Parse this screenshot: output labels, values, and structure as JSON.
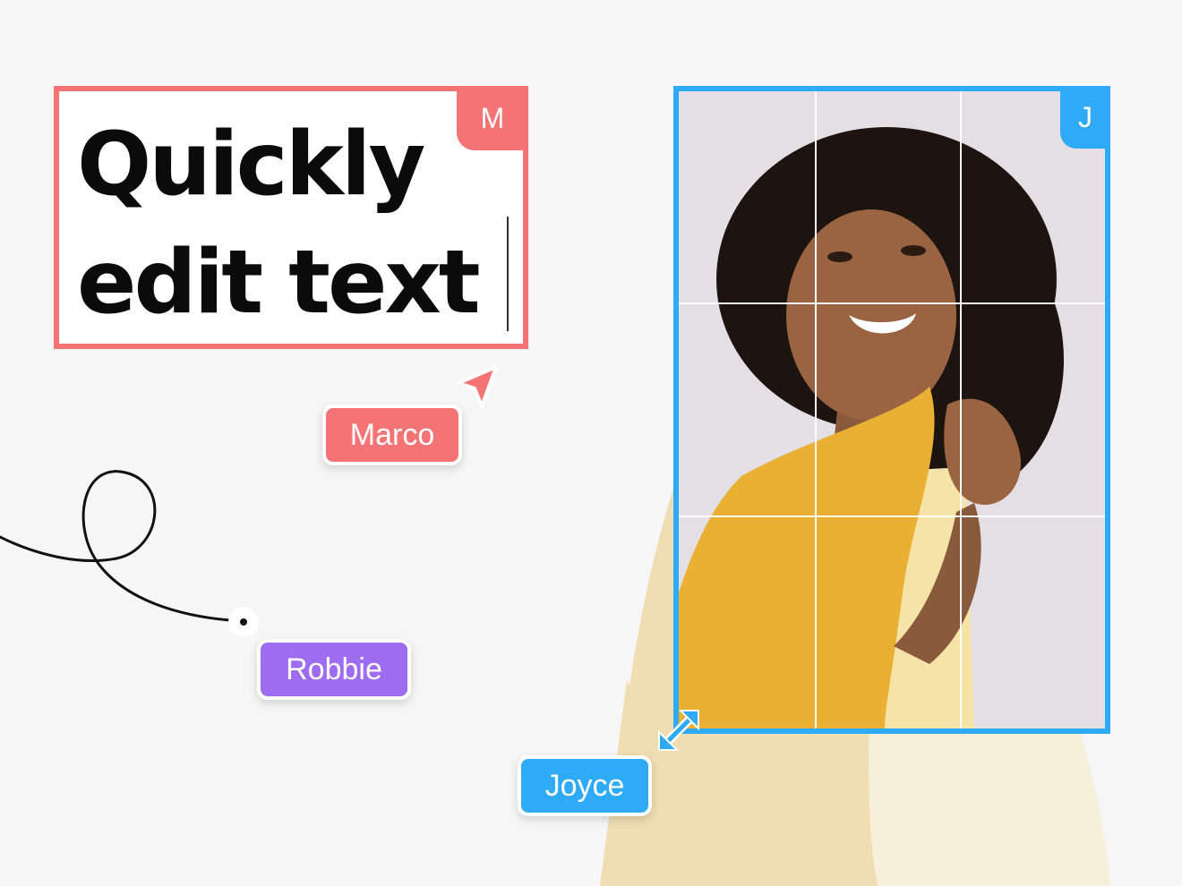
{
  "headline": {
    "line1": "Quickly",
    "line2": "edit text"
  },
  "collaborators": {
    "marco": {
      "name": "Marco",
      "initial": "M",
      "color": "#f47375"
    },
    "robbie": {
      "name": "Robbie",
      "color": "#9d6cf0"
    },
    "joyce": {
      "name": "Joyce",
      "initial": "J",
      "color": "#2eaaf6"
    }
  },
  "icons": {
    "cursor": "cursor-arrow-icon",
    "resize": "resize-diagonal-icon",
    "pen_point": "pen-point-icon"
  },
  "colors": {
    "background": "#f6f6f7",
    "photo_backdrop": "#e3dfe4",
    "jacket": "#e9b033",
    "shirt": "#f6e3a7"
  }
}
